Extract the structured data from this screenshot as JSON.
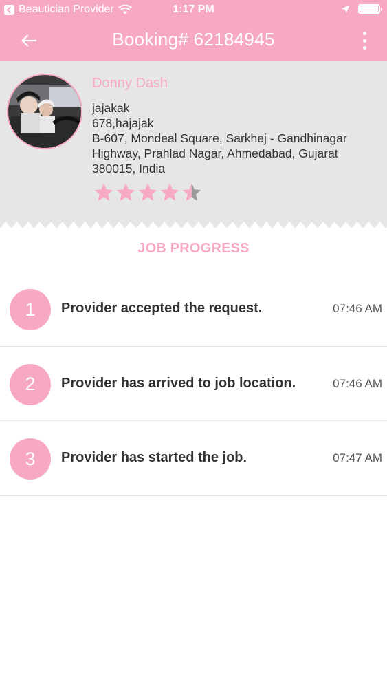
{
  "status_bar": {
    "carrier": "Beautician Provider",
    "time": "1:17 PM"
  },
  "nav": {
    "title": "Booking# 62184945"
  },
  "profile": {
    "name": "Donny Dash",
    "address_lines": [
      "jajakak",
      "678,hajajak",
      "B-607, Mondeal Square, Sarkhej - Gandhinagar",
      "Highway, Prahlad Nagar, Ahmedabad, Gujarat",
      "380015, India"
    ],
    "rating": 4.5,
    "rating_max": 5
  },
  "job_progress": {
    "title": "JOB PROGRESS",
    "steps": [
      {
        "number": "1",
        "text": "Provider accepted the request.",
        "time": "07:46 AM"
      },
      {
        "number": "2",
        "text": "Provider has arrived to job location.",
        "time": "07:46 AM"
      },
      {
        "number": "3",
        "text": "Provider has started the job.",
        "time": "07:47 AM"
      }
    ]
  },
  "colors": {
    "accent": "#f7a8c4",
    "profile_bg": "#e6e6e6",
    "star_empty": "#9a9a9a"
  }
}
